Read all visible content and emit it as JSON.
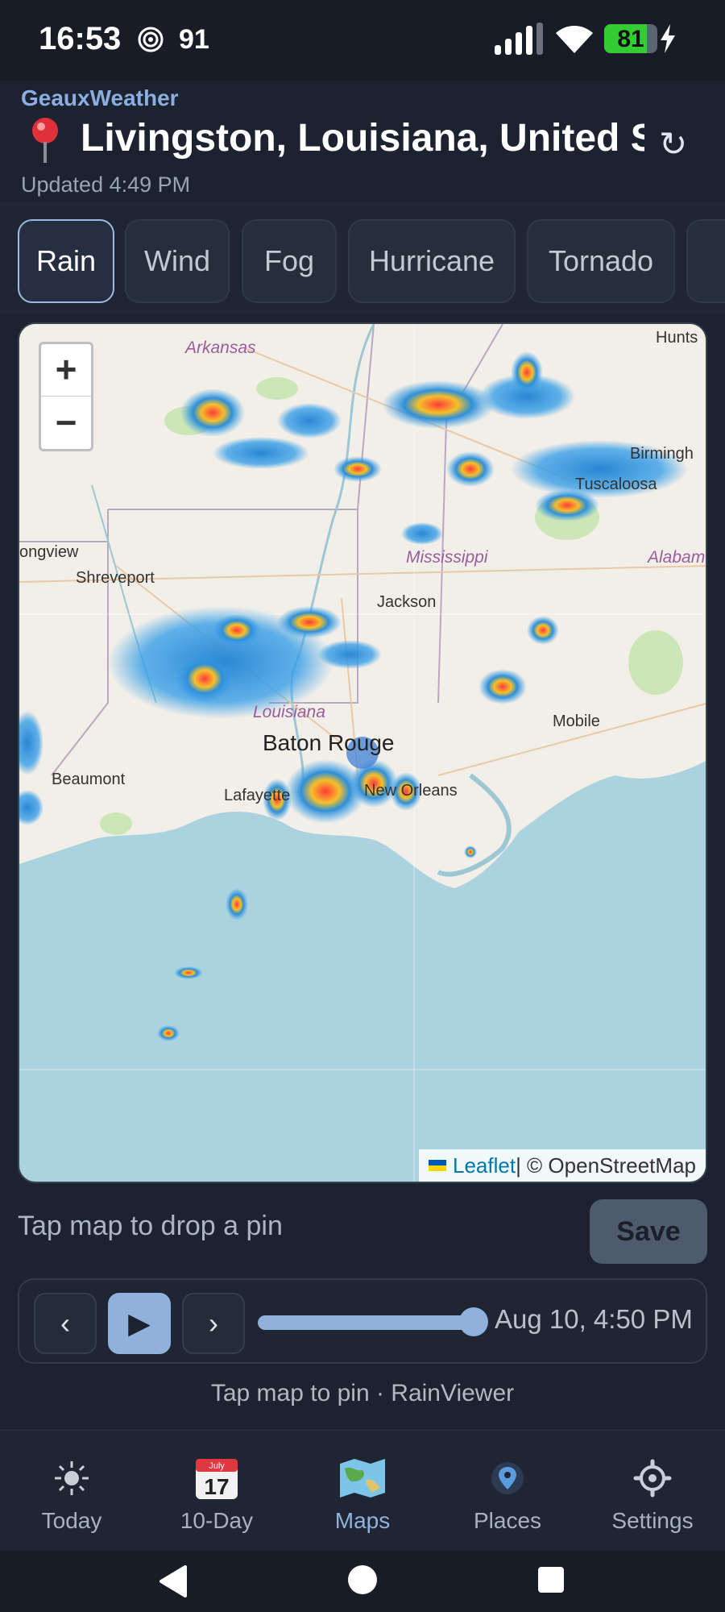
{
  "status_bar": {
    "time": "16:53",
    "temperature": "91",
    "battery": "81",
    "battery_level": 0.81
  },
  "header": {
    "app_name": "GeauxWeather",
    "location": "Livingston, Louisiana, United S…",
    "updated": "Updated 4:49 PM",
    "refresh_glyph": "↻"
  },
  "tabs": [
    {
      "label": "Rain",
      "active": true
    },
    {
      "label": "Wind",
      "active": false
    },
    {
      "label": "Fog",
      "active": false
    },
    {
      "label": "Hurricane",
      "active": false
    },
    {
      "label": "Tornado",
      "active": false
    }
  ],
  "map": {
    "zoom_in": "+",
    "zoom_out": "−",
    "attribution_leaflet": "Leaflet",
    "attribution_rest": " | © OpenStreetMap",
    "labels": {
      "arkansas": "Arkansas",
      "hunts": "Hunts",
      "birmingham": "Birmingh",
      "tuscaloosa": "Tuscaloosa",
      "longview": "ongview",
      "shreveport": "Shreveport",
      "mississippi": "Mississippi",
      "alabama": "Alabam",
      "jackson": "Jackson",
      "louisiana": "Louisiana",
      "baton_rouge": "Baton Rouge",
      "mobile": "Mobile",
      "beaumont": "Beaumont",
      "lafayette": "Lafayette",
      "new_orleans": "New Orleans"
    }
  },
  "pin_row": {
    "hint": "Tap map to drop a pin",
    "save_label": "Save"
  },
  "player": {
    "prev": "‹",
    "play": "▶",
    "next": "›",
    "progress": 1.0,
    "timestamp": "Aug 10, 4:50 PM"
  },
  "footnote": "Tap map to pin · RainViewer",
  "bottom_nav": [
    {
      "label": "Today",
      "icon": "sun-icon"
    },
    {
      "label": "10-Day",
      "icon": "calendar-icon",
      "calendar_month": "July",
      "calendar_day": "17"
    },
    {
      "label": "Maps",
      "icon": "map-icon",
      "active": true
    },
    {
      "label": "Places",
      "icon": "location-pin-icon"
    },
    {
      "label": "Settings",
      "icon": "gear-icon"
    }
  ],
  "colors": {
    "background": "#1c2230",
    "accent": "#8fb1dc",
    "water": "#aad3df",
    "land": "#f2efe9"
  }
}
